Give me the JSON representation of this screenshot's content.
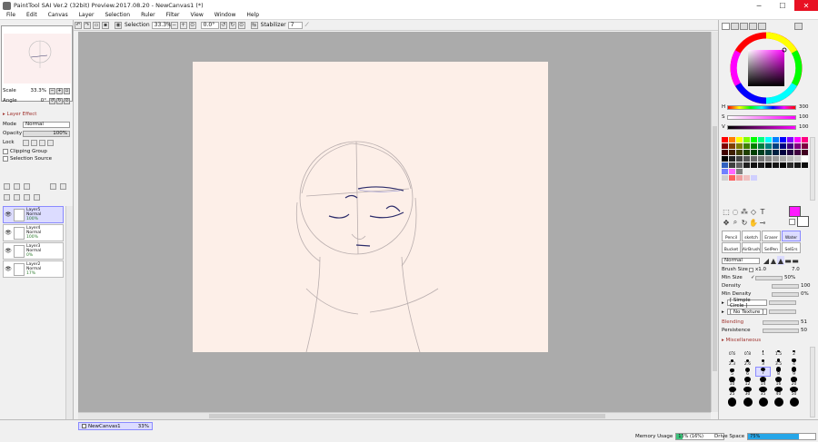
{
  "window": {
    "title": "PaintTool SAI Ver.2 (32bit) Preview.2017.08.20 - NewCanvas1 (*)",
    "minimize": "─",
    "maximize": "☐",
    "close": "✕"
  },
  "menu": [
    "File",
    "Edit",
    "Canvas",
    "Layer",
    "Selection",
    "Ruler",
    "Filter",
    "View",
    "Window",
    "Help"
  ],
  "toolbar": {
    "selection_label": "Selection",
    "zoom": "33.3%",
    "angle": "0.0°",
    "stabilizer_label": "Stabilizer",
    "stabilizer_value": "7"
  },
  "navigator": {
    "scale_label": "Scale",
    "scale_value": "33.3%",
    "angle_label": "Angle",
    "angle_value": "0°"
  },
  "layer_panel": {
    "layer_effect": "Layer Effect",
    "mode_label": "Mode",
    "mode_value": "Normal",
    "opacity_label": "Opacity",
    "opacity_value": "100%",
    "lock_label": "Lock",
    "clipping_group": "Clipping Group",
    "selection_source": "Selection Source",
    "layers": [
      {
        "name": "Layer5",
        "mode": "Normal",
        "opacity": "100%",
        "selected": true
      },
      {
        "name": "Layer4",
        "mode": "Normal",
        "opacity": "100%",
        "selected": false
      },
      {
        "name": "Layer3",
        "mode": "Normal",
        "opacity": "0%",
        "selected": false
      },
      {
        "name": "Layer2",
        "mode": "Normal",
        "opacity": "17%",
        "selected": false
      }
    ]
  },
  "color_panel": {
    "h_label": "H",
    "h_value": "300",
    "s_label": "S",
    "s_value": "100",
    "v_label": "V",
    "v_value": "100",
    "main_color": "#ff1aff",
    "palette_rows": [
      [
        "#ff0000",
        "#ff8000",
        "#ffff00",
        "#80ff00",
        "#00ff00",
        "#00ff80",
        "#00ffff",
        "#0080ff",
        "#0000ff",
        "#8000ff",
        "#ff00ff",
        "#ff0080"
      ],
      [
        "#800000",
        "#804000",
        "#808000",
        "#408000",
        "#008000",
        "#008040",
        "#008080",
        "#004080",
        "#000080",
        "#400080",
        "#800080",
        "#800040"
      ],
      [
        "#400000",
        "#402000",
        "#404000",
        "#204000",
        "#004000",
        "#004020",
        "#004040",
        "#002040",
        "#000040",
        "#200040",
        "#400040",
        "#400020"
      ],
      [
        "#000000",
        "#222222",
        "#444444",
        "#555555",
        "#666666",
        "#777777",
        "#888888",
        "#999999",
        "#aaaaaa",
        "#bbbbbb",
        "#cccccc",
        "#ffffff"
      ],
      [
        "#3060c0",
        "#404040",
        "#606060",
        "#202020",
        "#101010",
        "#1a1a1a",
        "#0a0a0a",
        "#151515",
        "#050505",
        "#2a2a2a",
        "#181818",
        "#0f0f0f"
      ],
      [
        "#7080ff",
        "#ff66ff",
        "#808080",
        "#f0f0f0",
        "#f0f0f0",
        "#f0f0f0",
        "#f0f0f0",
        "#f0f0f0",
        "#f0f0f0",
        "#f0f0f0",
        "#f0f0f0",
        "#f0f0f0"
      ],
      [
        "#d0d0d0",
        "#ff6060",
        "#f0a0a0",
        "#f0c0c0",
        "#d0d0ff",
        "#f0f0f0",
        "#f0f0f0",
        "#f0f0f0",
        "#f0f0f0",
        "#f0f0f0",
        "#f0f0f0",
        "#f0f0f0"
      ]
    ]
  },
  "tools": {
    "brushes": [
      "Pencil",
      "sketch",
      "Eraser",
      "Water",
      "Bucket",
      "AirBrush",
      "SelPen",
      "SelErs"
    ],
    "blend_mode": "Normal",
    "brush_size_label": "Brush Size",
    "brush_size_mult": "x1.0",
    "brush_size_value": "7.0",
    "min_size_label": "Min Size",
    "min_size_value": "50%",
    "density_label": "Density",
    "density_value": "100",
    "min_density_label": "Min Density",
    "min_density_value": "0%",
    "shape": "[ Simple Circle ]",
    "texture": "[ No Texture ]",
    "blending_label": "Blending",
    "blending_value": "51",
    "persistence_label": "Persistence",
    "persistence_value": "50",
    "misc_label": "Miscellaneous",
    "sizes": [
      [
        "0.6",
        "0.8",
        "1",
        "1.5",
        "2"
      ],
      [
        "2.3",
        "2.6",
        "3",
        "3.5",
        "4"
      ],
      [
        "5",
        "6",
        "7",
        "8",
        "9"
      ],
      [
        "10",
        "12",
        "14",
        "16",
        "20"
      ],
      [
        "25",
        "30",
        "35",
        "40",
        "50"
      ],
      [
        "",
        "",
        "",
        "",
        ""
      ]
    ]
  },
  "status": {
    "canvas_tab": "NewCanvas1",
    "canvas_zoom": "33%",
    "memory_label": "Memory Usage",
    "memory_value": "13% (16%)",
    "memory_fraction": 0.13,
    "drive_label": "Drive Space",
    "drive_value": "75%",
    "drive_fraction": 0.75
  }
}
